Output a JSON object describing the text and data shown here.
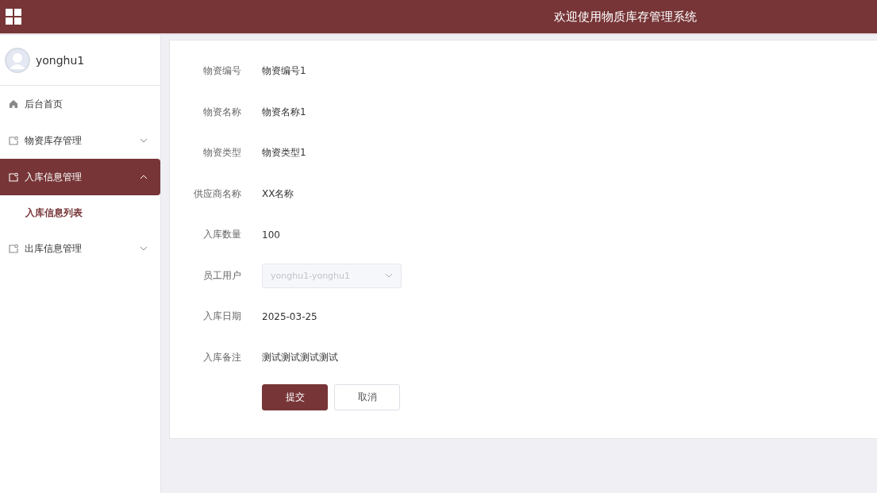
{
  "header": {
    "title": "欢迎使用物质库存管理系统"
  },
  "user": {
    "name": "yonghu1"
  },
  "menu": [
    {
      "kind": "home",
      "label": "后台首页",
      "selected": false
    },
    {
      "kind": "group",
      "label": "物资库存管理",
      "selected": false,
      "expanded": false
    },
    {
      "kind": "group",
      "label": "入库信息管理",
      "selected": true,
      "expanded": true,
      "children": [
        {
          "label": "入库信息列表",
          "selected": true
        }
      ]
    },
    {
      "kind": "group",
      "label": "出库信息管理",
      "selected": false,
      "expanded": false
    }
  ],
  "form": {
    "fields": [
      {
        "kind": "text",
        "label": "物资编号",
        "value": "物资编号1"
      },
      {
        "kind": "text",
        "label": "物资名称",
        "value": "物资名称1"
      },
      {
        "kind": "text",
        "label": "物资类型",
        "value": "物资类型1"
      },
      {
        "kind": "text",
        "label": "供应商名称",
        "value": "XX名称"
      },
      {
        "kind": "text",
        "label": "入库数量",
        "value": "100"
      },
      {
        "kind": "select",
        "label": "员工用户",
        "value": "yonghu1-yonghu1",
        "disabled": true
      },
      {
        "kind": "text",
        "label": "入库日期",
        "value": "2025-03-25"
      },
      {
        "kind": "text",
        "label": "入库备注",
        "value": "测试测试测试测试"
      }
    ],
    "buttons": [
      {
        "kind": "primary",
        "label": "提交"
      },
      {
        "kind": "default",
        "label": "取消"
      }
    ]
  }
}
